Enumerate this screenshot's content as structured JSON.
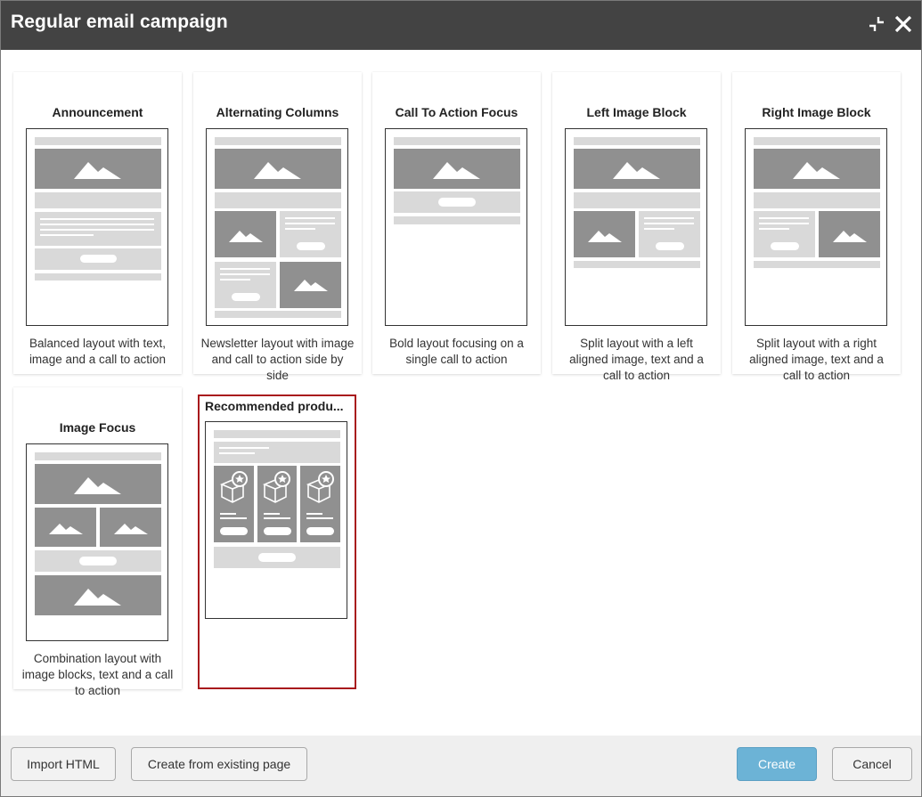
{
  "dialog": {
    "title": "Regular email campaign",
    "buttons": {
      "minimize_icon": "minimize-icon",
      "close_icon": "close-icon"
    }
  },
  "templates": [
    {
      "title": "Announcement",
      "description": "Balanced layout with text, image and a call to action",
      "selected": false
    },
    {
      "title": "Alternating Columns",
      "description": "Newsletter layout with image and call to action side by side",
      "selected": false
    },
    {
      "title": "Call To Action Focus",
      "description": "Bold layout focusing on a single call to action",
      "selected": false
    },
    {
      "title": "Left Image Block",
      "description": "Split layout with a left aligned image, text and a call to action",
      "selected": false
    },
    {
      "title": "Right Image Block",
      "description": "Split layout with a right aligned image, text and a call to action",
      "selected": false
    },
    {
      "title": "Image Focus",
      "description": "Combination layout with image blocks, text and a call to action",
      "selected": false
    },
    {
      "title": "Recommended produ...",
      "description": "",
      "selected": true
    }
  ],
  "footer": {
    "import_html": "Import HTML",
    "create_from_existing": "Create from existing page",
    "create": "Create",
    "cancel": "Cancel"
  },
  "colors": {
    "titlebar": "#434343",
    "selected_outline": "#a8191c",
    "primary_button": "#6cb3d6",
    "thumb_dark": "#909090",
    "thumb_light": "#d9d9d9"
  }
}
